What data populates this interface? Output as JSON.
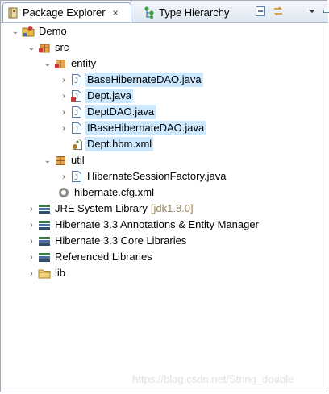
{
  "tabs": {
    "active": {
      "label": "Package Explorer",
      "icon": "package-explorer-icon",
      "close": "×"
    },
    "inactive": {
      "label": "Type Hierarchy",
      "icon": "type-hierarchy-icon"
    }
  },
  "tree": {
    "project": "Demo",
    "src": "src",
    "entity": "entity",
    "files_entity": [
      "BaseHibernateDAO.java",
      "Dept.java",
      "DeptDAO.java",
      "IBaseHibernateDAO.java",
      "Dept.hbm.xml"
    ],
    "util": "util",
    "file_util": "HibernateSessionFactory.java",
    "cfg": "hibernate.cfg.xml",
    "jre": "JRE System Library",
    "jre_deco": "[jdk1.8.0]",
    "lib1": "Hibernate 3.3 Annotations & Entity Manager",
    "lib2": "Hibernate 3.3 Core Libraries",
    "ref": "Referenced Libraries",
    "libfolder": "lib"
  },
  "arrows": {
    "expanded": "⌄",
    "collapsed": "›"
  },
  "watermark": "https://blog.csdn.net/String_double",
  "colors": {
    "selection": "#cce8ff",
    "decoration": "#96855a",
    "tab_border": "#8aa3c4"
  }
}
